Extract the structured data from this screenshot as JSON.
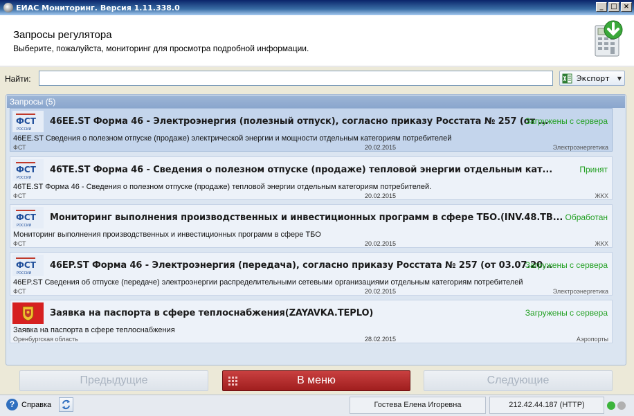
{
  "window": {
    "title": "ЕИАС Мониторинг. Версия 1.11.338.0",
    "controls": [
      "_",
      "□",
      "×"
    ]
  },
  "header": {
    "title": "Запросы регулятора",
    "subtitle": "Выберите, пожалуйста, мониторинг для просмотра подробной информации."
  },
  "search": {
    "label": "Найти:",
    "value": "",
    "placeholder": ""
  },
  "export": {
    "label": "Экспорт"
  },
  "panel": {
    "title": "Запросы (5)"
  },
  "requests": [
    {
      "title": "46EE.ST  Форма 46 - Электроэнергия (полезный отпуск), согласно приказу Росстата № 257 (от ...",
      "status": "Загружены с сервера",
      "description": "46EE.ST  Сведения о полезном отпуске (продаже) электрической энергии и мощности отдельным категориям потребителей",
      "org": "ФСТ",
      "date": "20.02.2015",
      "sector": "Электроэнергетика",
      "logo": "fst-logo"
    },
    {
      "title": "46TE.ST  Форма 46 - Сведения о полезном отпуске (продаже) тепловой энергии отдельным кат...",
      "status": "Принят",
      "description": "46TE.ST  Форма 46 - Сведения о полезном отпуске (продаже) тепловой энергии отдельным категориям потребителей.",
      "org": "ФСТ",
      "date": "20.02.2015",
      "sector": "ЖКХ",
      "logo": "fst-logo"
    },
    {
      "title": "Мониторинг выполнения производственных и инвестиционных программ в сфере ТБО.(INV.48.TB...",
      "status": "Обработан",
      "description": "Мониторинг выполнения производственных и инвестиционных программ в сфере ТБО",
      "org": "ФСТ",
      "date": "20.02.2015",
      "sector": "ЖКХ",
      "logo": "fst-logo"
    },
    {
      "title": "46EP.ST  Форма 46 - Электроэнергия (передача), согласно приказу Росстата № 257 (от 03.07.20...",
      "status": "Загружены с сервера",
      "description": "46EP.ST  Сведения об отпуске (передаче) электроэнергии распределительными сетевыми организациями отдельным категориям потребителей",
      "org": "ФСТ",
      "date": "20.02.2015",
      "sector": "Электроэнергетика",
      "logo": "fst-logo"
    },
    {
      "title": "Заявка на паспорта в сфере теплоснабжения(ZAYAVKA.TEPLO)",
      "status": "Загружены с сервера",
      "description": "Заявка на паспорта в сфере теплоснабжения",
      "org": "Оренбургская область",
      "date": "28.02.2015",
      "sector": "Аэропорты",
      "logo": "orenburg-coat-of-arms"
    }
  ],
  "nav": {
    "prev": "Предыдущие",
    "menu": "В меню",
    "next": "Следующие"
  },
  "statusbar": {
    "help": "Справка",
    "user": "Гостева Елена Игоревна",
    "server": "212.42.44.187 (HTTP)",
    "indicators": [
      {
        "name": "online",
        "color": "#3cb43c"
      },
      {
        "name": "secondary",
        "color": "#b0b0b0"
      }
    ]
  },
  "colors": {
    "status_green": "#22a022",
    "menu_button": "#b32a2a",
    "panel_header": "#8fa9cf",
    "selected_row": "#c4d5ec"
  }
}
